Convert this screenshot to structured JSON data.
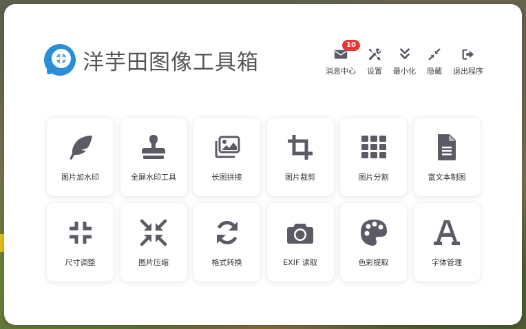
{
  "app": {
    "title": "洋芋田图像工具箱"
  },
  "topbar": {
    "items": [
      {
        "label": "消息中心",
        "icon": "envelope-icon",
        "badge": "10"
      },
      {
        "label": "设置",
        "icon": "tools-icon"
      },
      {
        "label": "最小化",
        "icon": "double-chevron-down-icon"
      },
      {
        "label": "隐藏",
        "icon": "compress-icon"
      },
      {
        "label": "退出程序",
        "icon": "sign-out-icon"
      }
    ]
  },
  "tools": [
    {
      "label": "图片加水印",
      "icon": "feather-icon"
    },
    {
      "label": "全屏水印工具",
      "icon": "stamp-icon"
    },
    {
      "label": "长图拼接",
      "icon": "images-icon"
    },
    {
      "label": "图片裁剪",
      "icon": "crop-icon"
    },
    {
      "label": "图片分割",
      "icon": "grid-icon"
    },
    {
      "label": "富文本制图",
      "icon": "file-text-icon"
    },
    {
      "label": "尺寸调整",
      "icon": "compress-arrows-icon"
    },
    {
      "label": "图片压缩",
      "icon": "compress-diagonal-icon"
    },
    {
      "label": "格式转换",
      "icon": "sync-icon"
    },
    {
      "label": "EXIF 读取",
      "icon": "camera-icon"
    },
    {
      "label": "色彩提取",
      "icon": "palette-icon"
    },
    {
      "label": "字体管理",
      "icon": "font-icon"
    }
  ],
  "colors": {
    "icon": "#5b5b66",
    "badge": "#e53935",
    "logo": "#2a8fd8"
  }
}
